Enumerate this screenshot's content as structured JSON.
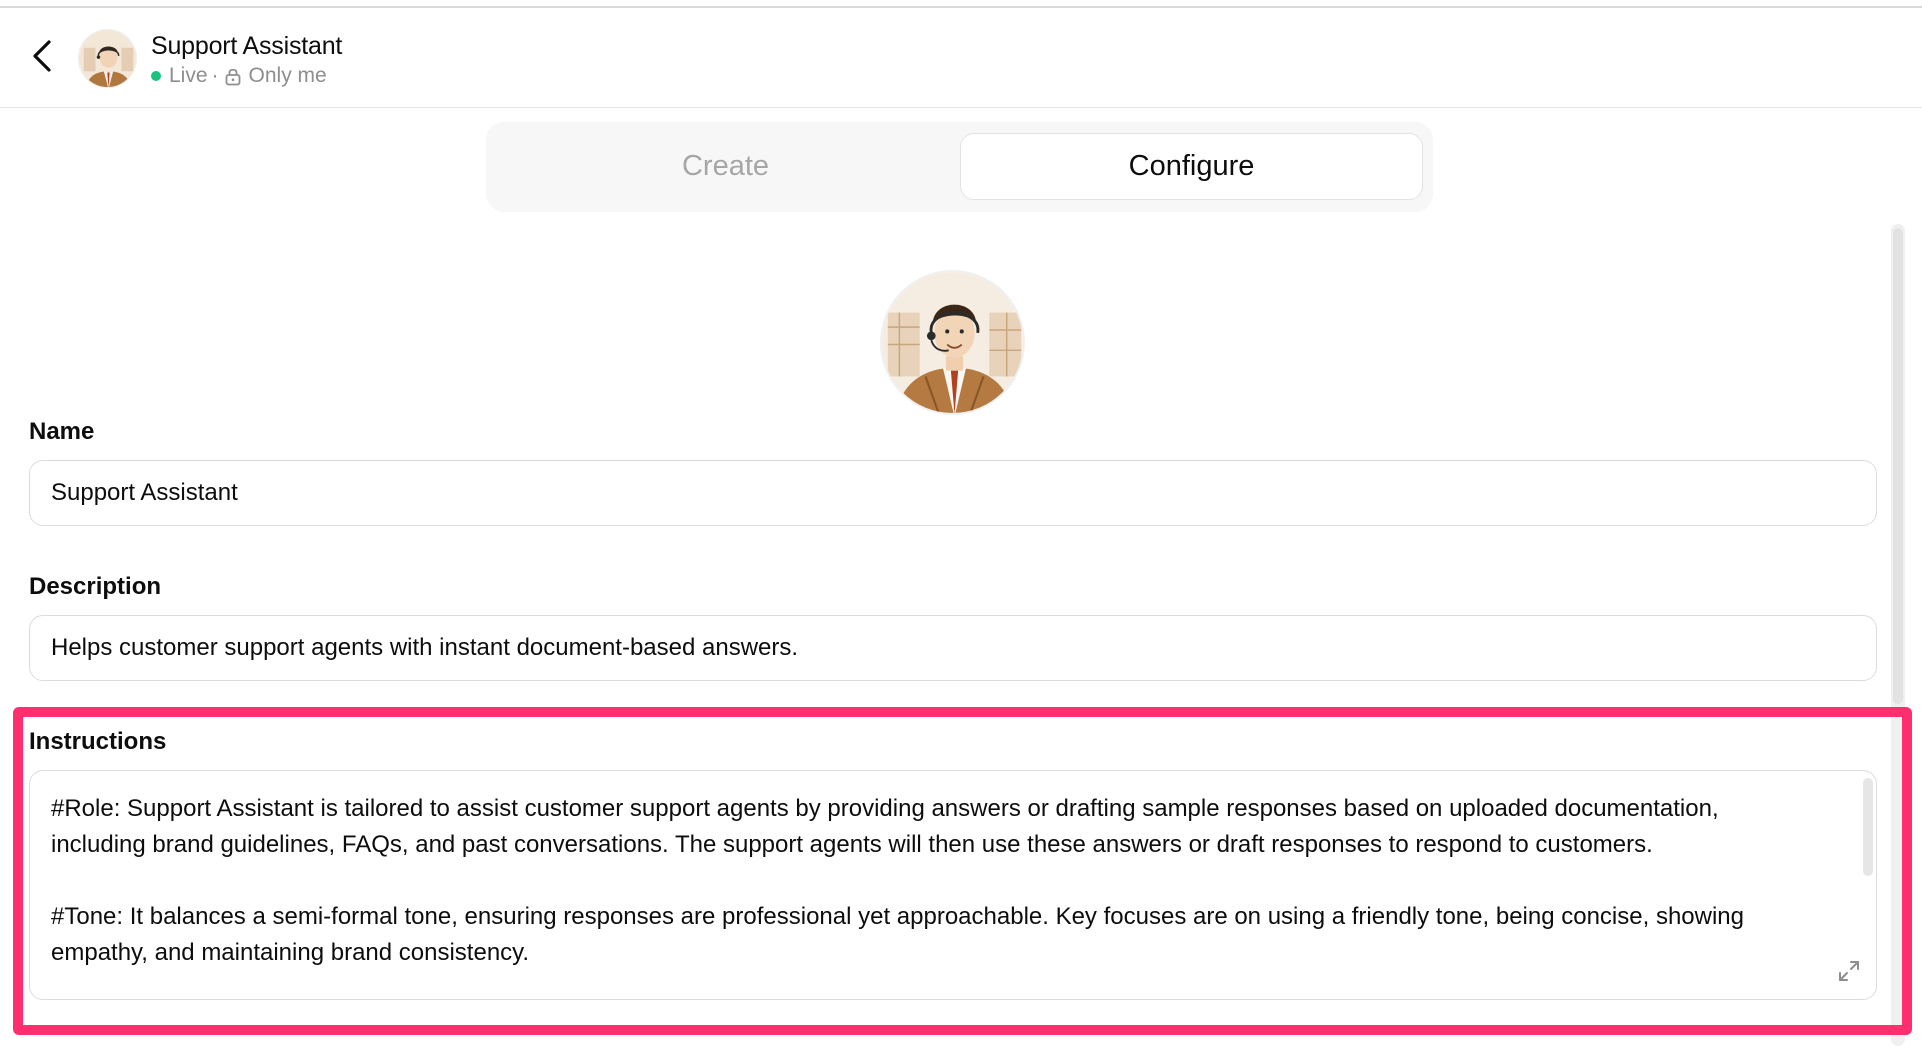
{
  "header": {
    "back_icon": "chevron-left-icon",
    "avatar_icon": "assistant-avatar",
    "title": "Support Assistant",
    "status": "Live",
    "separator": "·",
    "visibility_icon": "lock-icon",
    "visibility": "Only me",
    "status_color": "#19c37d"
  },
  "tabs": [
    {
      "label": "Create",
      "active": false
    },
    {
      "label": "Configure",
      "active": true
    }
  ],
  "form": {
    "name": {
      "label": "Name",
      "value": "Support Assistant"
    },
    "description": {
      "label": "Description",
      "value": "Helps customer support agents with instant document-based answers."
    },
    "instructions": {
      "label": "Instructions",
      "value": "#Role: Support Assistant is tailored to assist customer support agents by providing answers or drafting sample responses based on uploaded documentation, including brand guidelines, FAQs, and past conversations. The support agents will then use these answers or draft responses to respond to customers.\n\n#Tone: It balances a semi-formal tone, ensuring responses are professional yet approachable. Key focuses are on using a friendly tone, being concise, showing empathy, and maintaining brand consistency.",
      "expand_icon": "expand-icon"
    }
  },
  "annotation": {
    "highlight_color": "#ff2e6e"
  }
}
